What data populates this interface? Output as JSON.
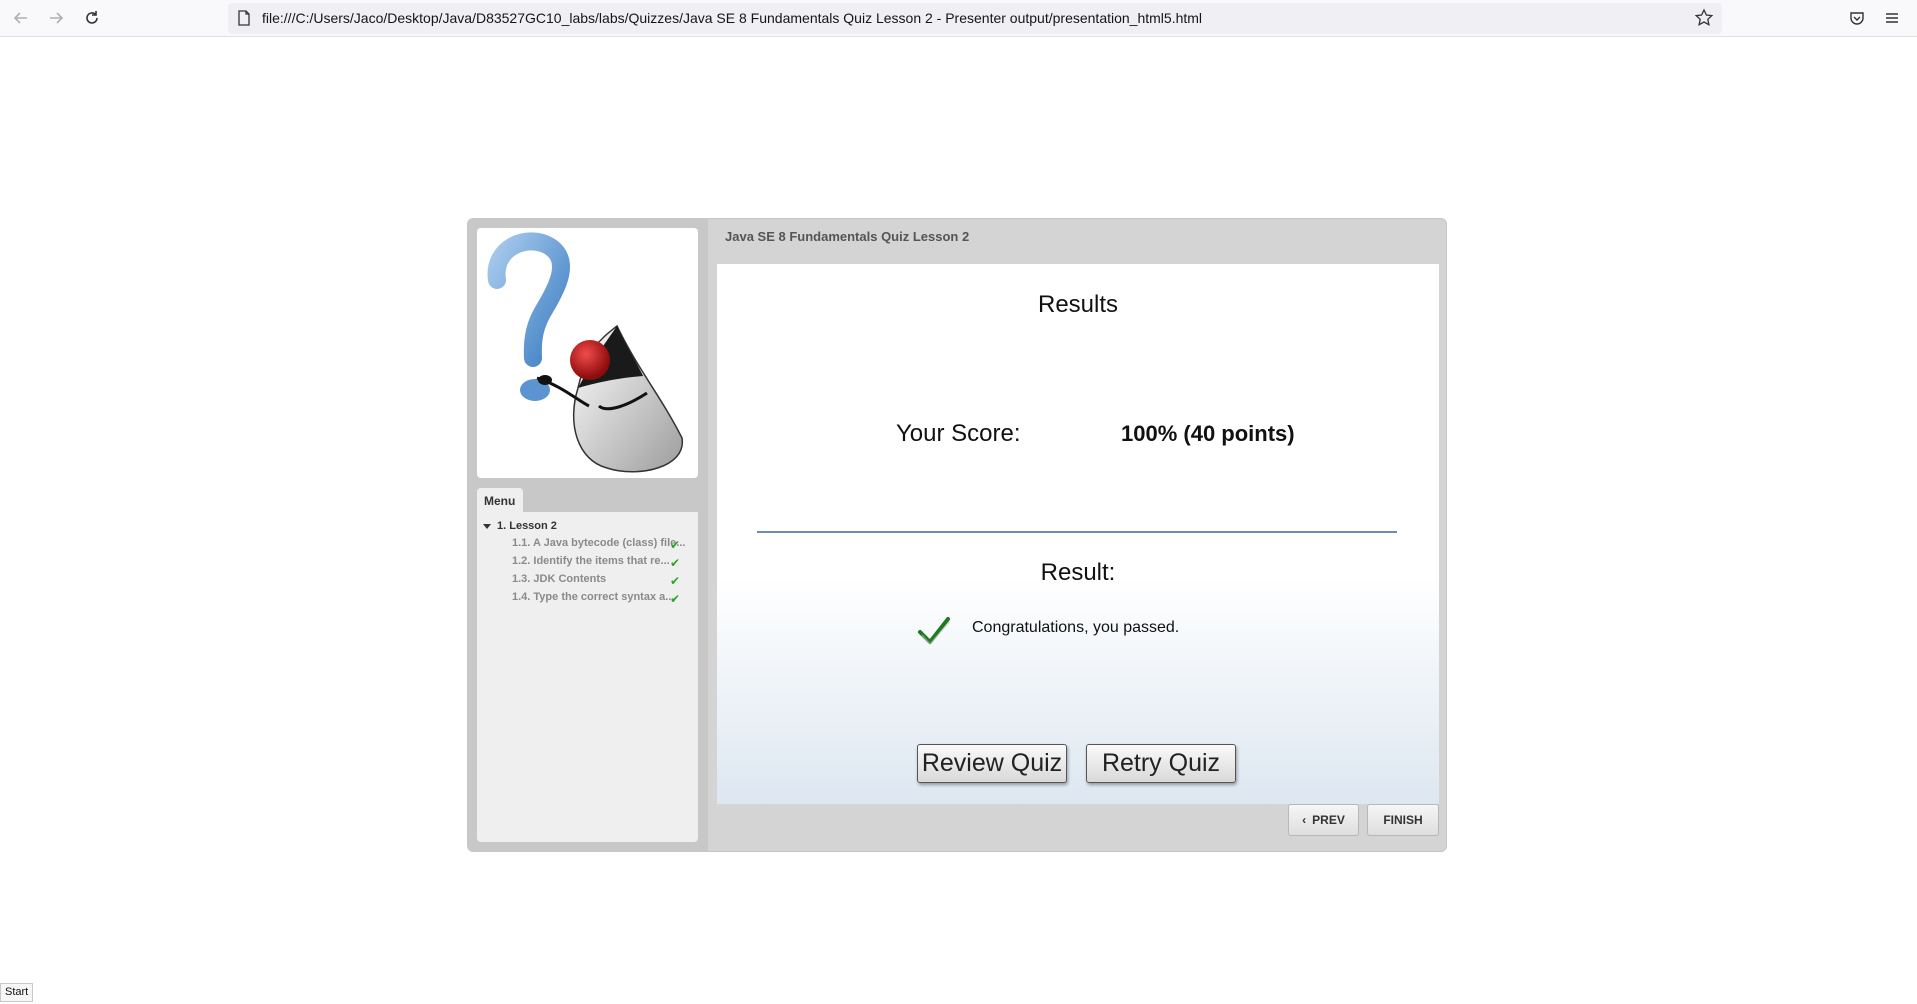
{
  "browser": {
    "url": "file:///C:/Users/Jaco/Desktop/Java/D83527GC10_labs/labs/Quizzes/Java SE 8 Fundamentals Quiz Lesson 2 - Presenter output/presentation_html5.html",
    "icons": [
      "back-icon",
      "forward-icon",
      "reload-icon",
      "page-icon",
      "bookmark-star-icon",
      "pocket-icon",
      "menu-icon"
    ]
  },
  "sidebar": {
    "menu_tab": "Menu",
    "lesson": "1. Lesson 2",
    "items": [
      {
        "label": "1.1. A Java bytecode (class) file...",
        "completed": true
      },
      {
        "label": "1.2. Identify the items that re...",
        "completed": true
      },
      {
        "label": "1.3. JDK Contents",
        "completed": true
      },
      {
        "label": "1.4. Type the correct syntax a...",
        "completed": true
      }
    ],
    "check_glyph": "✔"
  },
  "quiz": {
    "title": "Java SE 8 Fundamentals Quiz Lesson 2",
    "results_heading": "Results",
    "score_label": "Your Score:",
    "score_value": "100% (40 points)",
    "result_label": "Result:",
    "result_message": "Congratulations, you passed.",
    "review_button": "Review Quiz",
    "retry_button": "Retry Quiz",
    "prev_button": "PREV",
    "finish_button": "FINISH"
  },
  "status_bar": {
    "text": "Start"
  },
  "colors": {
    "check_green": "#2aa52a",
    "divider_blue": "#6f8db0",
    "player_bg": "#d4d4d4"
  }
}
